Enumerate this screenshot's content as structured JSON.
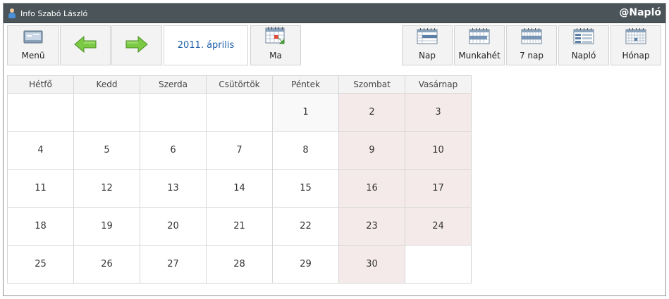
{
  "titlebar": {
    "user": "Info Szabó László",
    "app": "@Napló"
  },
  "toolbar": {
    "menu_label": "Menü",
    "month_label": "2011. április",
    "today_label": "Ma",
    "views": [
      "Nap",
      "Munkahét",
      "7 nap",
      "Napló",
      "Hónap"
    ]
  },
  "calendar": {
    "weekdays": [
      "Hétfő",
      "Kedd",
      "Szerda",
      "Csütörtök",
      "Péntek",
      "Szombat",
      "Vasárnap"
    ],
    "weeks": [
      [
        "",
        "",
        "",
        "",
        "1",
        "2",
        "3"
      ],
      [
        "4",
        "5",
        "6",
        "7",
        "8",
        "9",
        "10"
      ],
      [
        "11",
        "12",
        "13",
        "14",
        "15",
        "16",
        "17"
      ],
      [
        "18",
        "19",
        "20",
        "21",
        "22",
        "23",
        "24"
      ],
      [
        "25",
        "26",
        "27",
        "28",
        "29",
        "30",
        ""
      ]
    ]
  },
  "colors": {
    "titlebar": "#4a5459",
    "weekend": "#f5eaea",
    "arrow": "#6cbf3a",
    "month_text": "#1f5fa8"
  }
}
